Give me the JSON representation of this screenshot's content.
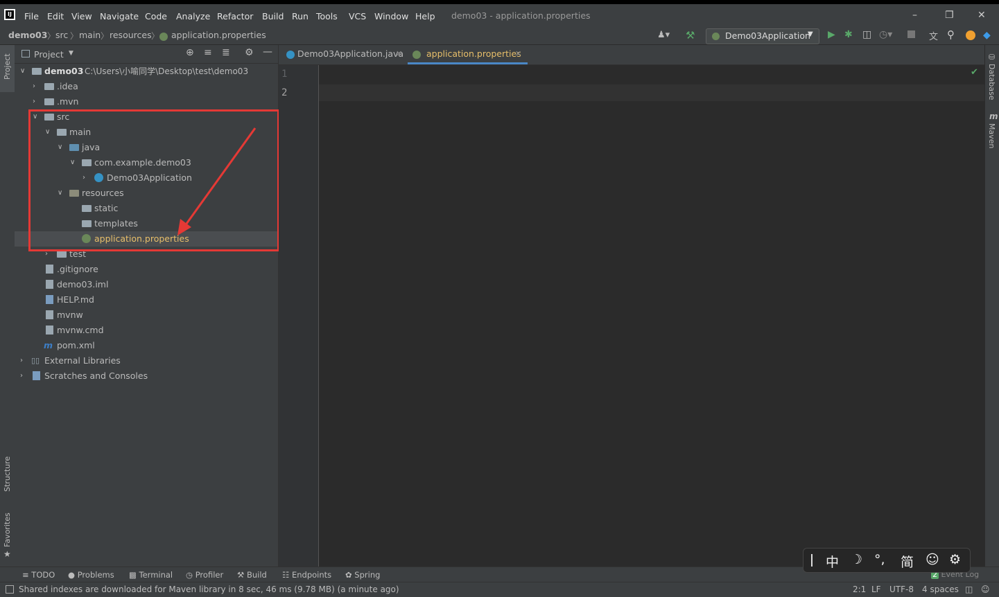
{
  "menu": [
    "File",
    "Edit",
    "View",
    "Navigate",
    "Code",
    "Analyze",
    "Refactor",
    "Build",
    "Run",
    "Tools",
    "VCS",
    "Window",
    "Help"
  ],
  "window_title": "demo03 - application.properties",
  "breadcrumb": [
    "demo03",
    "src",
    "main",
    "resources",
    "application.properties"
  ],
  "run_config": "Demo03Application",
  "project_panel": {
    "title": "Project",
    "tree": [
      {
        "label": "demo03",
        "path": "C:\\Users\\小喻同学\\Desktop\\test\\demo03"
      },
      {
        "label": ".idea"
      },
      {
        "label": ".mvn"
      },
      {
        "label": "src"
      },
      {
        "label": "main"
      },
      {
        "label": "java"
      },
      {
        "label": "com.example.demo03"
      },
      {
        "label": "Demo03Application"
      },
      {
        "label": "resources"
      },
      {
        "label": "static"
      },
      {
        "label": "templates"
      },
      {
        "label": "application.properties"
      },
      {
        "label": "test"
      },
      {
        "label": ".gitignore"
      },
      {
        "label": "demo03.iml"
      },
      {
        "label": "HELP.md"
      },
      {
        "label": "mvnw"
      },
      {
        "label": "mvnw.cmd"
      },
      {
        "label": "pom.xml"
      },
      {
        "label": "External Libraries"
      },
      {
        "label": "Scratches and Consoles"
      }
    ]
  },
  "tabs": [
    {
      "label": "Demo03Application.java"
    },
    {
      "label": "application.properties"
    }
  ],
  "line_numbers": [
    "1",
    "2"
  ],
  "left_strip": {
    "project": "Project",
    "structure": "Structure",
    "favorites": "Favorites"
  },
  "right_strip": {
    "database": "Database",
    "maven": "Maven"
  },
  "bottom_tools": [
    "TODO",
    "Problems",
    "Terminal",
    "Profiler",
    "Build",
    "Endpoints",
    "Spring"
  ],
  "event_log": {
    "count": "2",
    "label": "Event Log"
  },
  "status": {
    "message": "Shared indexes are downloaded for Maven library in 8 sec, 46 ms (9.78 MB) (a minute ago)",
    "position": "2:1",
    "line_sep": "LF",
    "encoding": "UTF-8",
    "indent": "4 spaces"
  },
  "ime": [
    "中",
    "☽",
    "°,",
    "简",
    "☺",
    "⚙"
  ],
  "colors": {
    "accent": "#4a88c7",
    "highlight": "#e53935",
    "selected_file": "#e8bf6a"
  }
}
